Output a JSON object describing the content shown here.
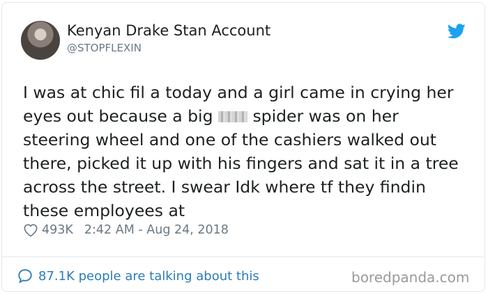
{
  "tweet": {
    "author_name": "Kenyan Drake Stan Account",
    "author_handle": "@STOPFLEXIN",
    "text_before_censor": "I was at chic fil a today and a girl came in crying her eyes out because a big ",
    "text_after_censor": " spider was on her steering wheel and one of the cashiers walked out there, picked it up with his fingers and sat it in a tree across the street. I swear Idk where tf they findin these employees at",
    "likes": "493K",
    "timestamp": "2:42 AM - Aug 24, 2018",
    "talking_label": "87.1K people are talking about this"
  },
  "icons": {
    "brand": "twitter-bird-icon",
    "like": "heart-icon",
    "conversation": "speech-bubble-icon"
  },
  "colors": {
    "twitter_blue": "#1da1f2",
    "link_blue": "#2b7bb9",
    "meta_gray": "#697882"
  },
  "watermark": "boredpanda.com"
}
